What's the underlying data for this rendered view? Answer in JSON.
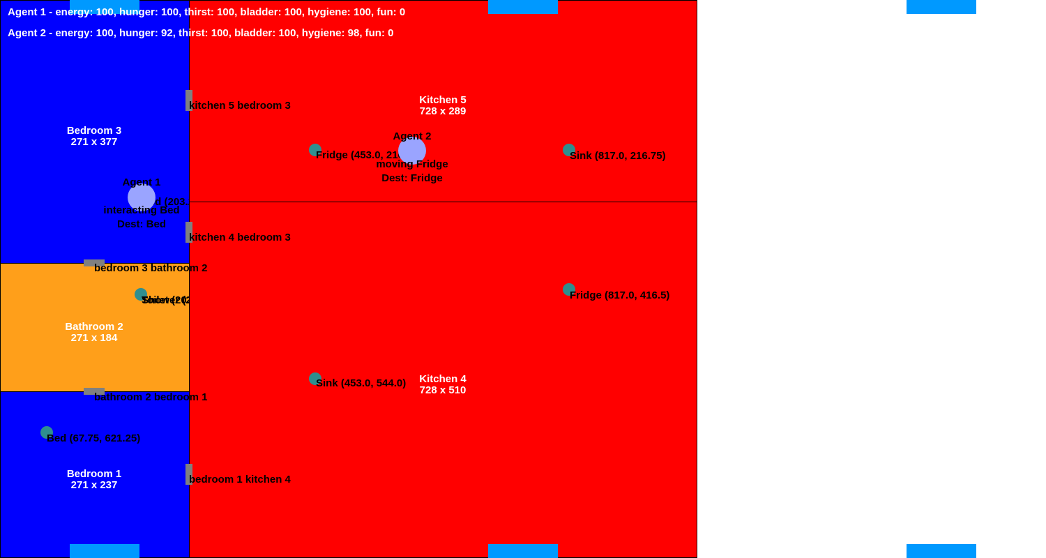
{
  "colors": {
    "bedroom": "#0000ff",
    "kitchen": "#ff0000",
    "bathroom": "#ff9f1a",
    "object": "#2f8f8f",
    "agent": "#9aa4ff",
    "door": "#808080",
    "spawn": "#0099ff"
  },
  "status": {
    "agent1": "Agent 1 - energy: 100, hunger: 100, thirst: 100, bladder: 100, hygiene: 100, fun: 0",
    "agent2": "Agent 2 - energy: 100, hunger: 92, thirst: 100, bladder: 100, hygiene: 98, fun: 0"
  },
  "rooms": {
    "bedroom3": {
      "name": "Bedroom 3",
      "size": "271 x 377"
    },
    "kitchen5": {
      "name": "Kitchen 5",
      "size": "728 x 289"
    },
    "bathroom2": {
      "name": "Bathroom 2",
      "size": "271 x 184"
    },
    "kitchen4": {
      "name": "Kitchen 4",
      "size": "728 x 510"
    },
    "bedroom1": {
      "name": "Bedroom 1",
      "size": "271 x 237"
    }
  },
  "doors": {
    "k5b3": "kitchen 5 bedroom 3",
    "k4b3": "kitchen 4 bedroom 3",
    "b3ba2": "bedroom 3 bathroom 2",
    "ba2b1": "bathroom 2 bedroom 1",
    "b1k4": "bedroom 1 kitchen 4"
  },
  "objects": {
    "fridge_k5": "Fridge (453.0, 216.75)",
    "sink_k5": "Sink (817.0, 216.75)",
    "bed_b3": "Bed (203.25, 282.75)",
    "toilet_ba2": "Toilet (203.25, 423.0)",
    "shower_ba2": "Shower (203.25, 423.0)",
    "fridge_k4": "Fridge (817.0, 416.5)",
    "sink_k4": "Sink (453.0, 544.0)",
    "bed_b1": "Bed (67.75, 621.25)"
  },
  "agents": {
    "agent1": {
      "name": "Agent 1",
      "action": "interacting Bed",
      "dest": "Dest: Bed"
    },
    "agent2": {
      "name": "Agent 2",
      "action": "moving Fridge",
      "dest": "Dest: Fridge"
    }
  }
}
